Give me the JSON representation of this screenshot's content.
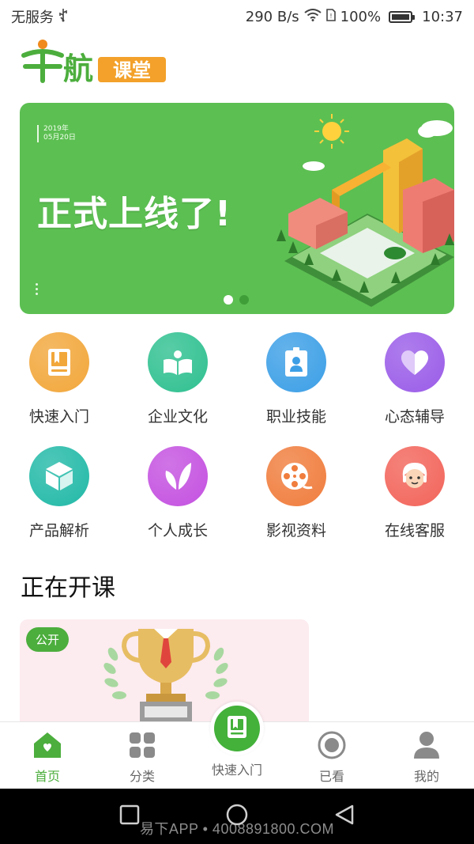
{
  "status_bar": {
    "carrier": "无服务",
    "usb_icon": "usb-icon",
    "speed": "290 B/s",
    "wifi_icon": "wifi-icon",
    "sim_icon": "sim-icon",
    "battery_percent": "100%",
    "battery_level": 1.0,
    "time": "10:37"
  },
  "logo": {
    "name": "千航",
    "tag": "课堂"
  },
  "banner": {
    "date_line1": "2019年",
    "date_line2": "05月20日",
    "headline": "正式上线了!",
    "page_count": 2,
    "active_page": 1
  },
  "categories": [
    {
      "label": "快速入门",
      "icon": "book-icon",
      "color": "#f2a73b"
    },
    {
      "label": "企业文化",
      "icon": "open-book-icon",
      "color": "#2fc090"
    },
    {
      "label": "职业技能",
      "icon": "id-badge-icon",
      "color": "#3c9fe6"
    },
    {
      "label": "心态辅导",
      "icon": "heart-icon",
      "color": "#9a5ce8"
    },
    {
      "label": "产品解析",
      "icon": "cube-icon",
      "color": "#22b9a7"
    },
    {
      "label": "个人成长",
      "icon": "leaf-icon",
      "color": "#c451e0"
    },
    {
      "label": "影视资料",
      "icon": "film-reel-icon",
      "color": "#f07d3d"
    },
    {
      "label": "在线客服",
      "icon": "support-agent-icon",
      "color": "#f2645a"
    }
  ],
  "section": {
    "title": "正在开课"
  },
  "course_card": {
    "badge": "公开"
  },
  "bottom_nav": {
    "items": [
      {
        "label": "首页",
        "icon": "home-icon",
        "active": true
      },
      {
        "label": "分类",
        "icon": "grid-icon",
        "active": false
      },
      {
        "label": "快速入门",
        "icon": "book-icon",
        "active": false
      },
      {
        "label": "已看",
        "icon": "watched-icon",
        "active": false
      },
      {
        "label": "我的",
        "icon": "user-icon",
        "active": false
      }
    ]
  },
  "watermark": "易下APP • 4008891800.COM",
  "colors": {
    "brand_green": "#4cae3d",
    "banner_green": "#5cbf52"
  }
}
